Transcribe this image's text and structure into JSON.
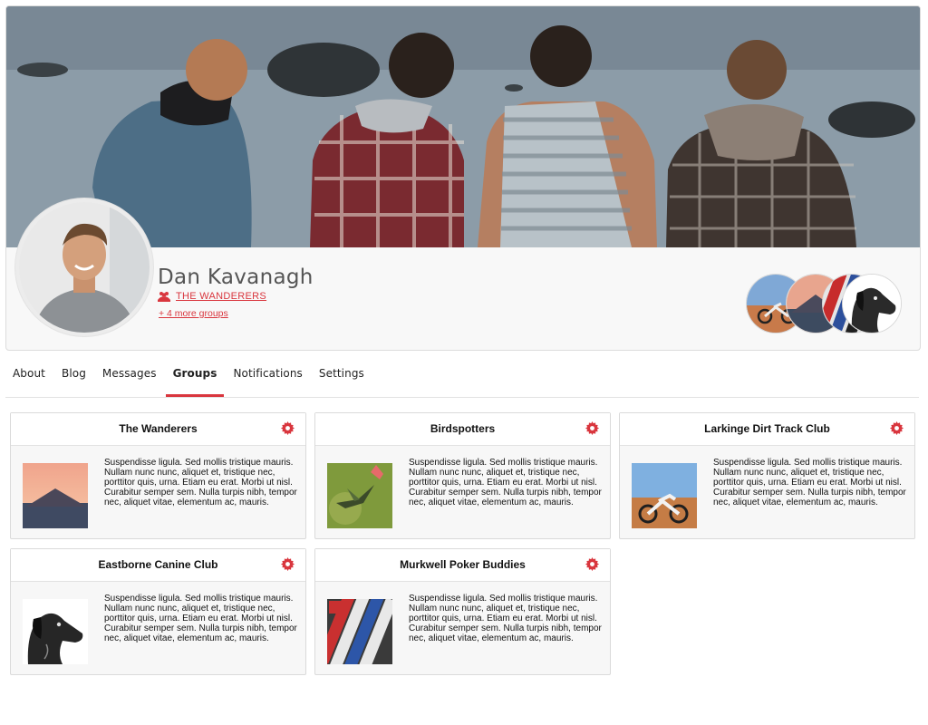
{
  "profile": {
    "name": "Dan Kavanagh",
    "primary_group": "THE WANDERERS",
    "more_groups": "+ 4 more groups",
    "accent_color": "#d9363e"
  },
  "tabs": [
    {
      "label": "About",
      "active": false
    },
    {
      "label": "Blog",
      "active": false
    },
    {
      "label": "Messages",
      "active": false
    },
    {
      "label": "Groups",
      "active": true
    },
    {
      "label": "Notifications",
      "active": false
    },
    {
      "label": "Settings",
      "active": false
    }
  ],
  "groups": [
    {
      "title": "The Wanderers",
      "description": "Suspendisse ligula. Sed mollis tristique mauris. Nullam nunc nunc, aliquet et, tristique nec, porttitor quis, urna. Etiam eu erat. Morbi ut nisl. Curabitur semper sem. Nulla turpis nibh, tempor nec, aliquet vitae, elementum ac, mauris.",
      "icon": "gear-icon"
    },
    {
      "title": "Birdspotters",
      "description": "Suspendisse ligula. Sed mollis tristique mauris. Nullam nunc nunc, aliquet et, tristique nec, porttitor quis, urna. Etiam eu erat. Morbi ut nisl. Curabitur semper sem. Nulla turpis nibh, tempor nec, aliquet vitae, elementum ac, mauris.",
      "icon": "gear-icon"
    },
    {
      "title": "Larkinge Dirt Track Club",
      "description": "Suspendisse ligula. Sed mollis tristique mauris. Nullam nunc nunc, aliquet et, tristique nec, porttitor quis, urna. Etiam eu erat. Morbi ut nisl. Curabitur semper sem. Nulla turpis nibh, tempor nec, aliquet vitae, elementum ac, mauris.",
      "icon": "gear-icon"
    },
    {
      "title": "Eastborne Canine Club",
      "description": "Suspendisse ligula. Sed mollis tristique mauris. Nullam nunc nunc, aliquet et, tristique nec, porttitor quis, urna. Etiam eu erat. Morbi ut nisl. Curabitur semper sem. Nulla turpis nibh, tempor nec, aliquet vitae, elementum ac, mauris.",
      "icon": "gear-icon"
    },
    {
      "title": "Murkwell Poker Buddies",
      "description": "Suspendisse ligula. Sed mollis tristique mauris. Nullam nunc nunc, aliquet et, tristique nec, porttitor quis, urna. Etiam eu erat. Morbi ut nisl. Curabitur semper sem. Nulla turpis nibh, tempor nec, aliquet vitae, elementum ac, mauris.",
      "icon": "gear-icon"
    }
  ]
}
